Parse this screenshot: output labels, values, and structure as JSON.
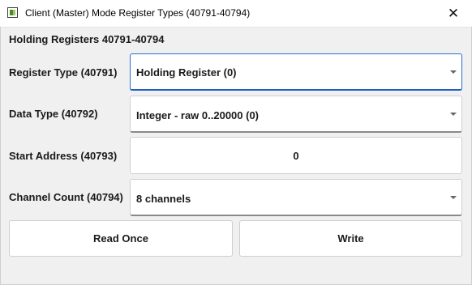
{
  "window": {
    "title": "Client (Master) Mode Register Types  (40791-40794)",
    "close_glyph": "✕",
    "app_icon": "app-icon"
  },
  "section": {
    "heading": "Holding Registers 40791-40794"
  },
  "fields": {
    "register_type": {
      "label": "Register Type (40791)",
      "value": "Holding Register (0)"
    },
    "data_type": {
      "label": "Data Type (40792)",
      "value": "Integer - raw 0..20000 (0)"
    },
    "start_address": {
      "label": "Start Address (40793)",
      "value": "0"
    },
    "channel_count": {
      "label": "Channel Count (40794)",
      "value": "8 channels"
    }
  },
  "buttons": {
    "read_once": "Read Once",
    "write": "Write"
  },
  "colors": {
    "focus_accent": "#2a6fd6",
    "background": "#f0f0f0"
  }
}
